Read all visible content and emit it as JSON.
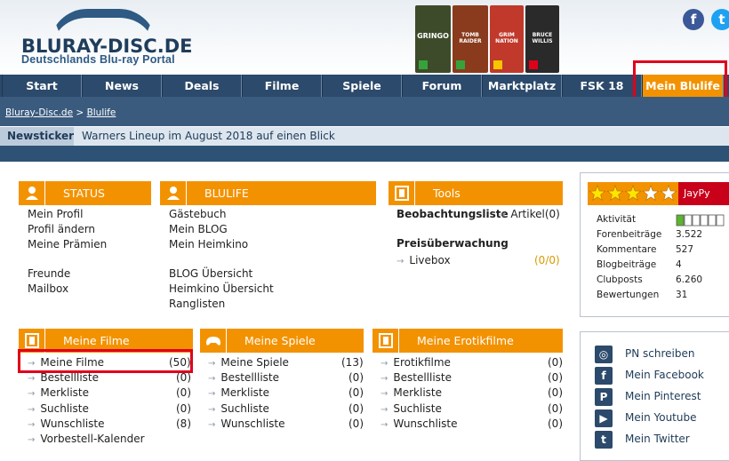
{
  "site": {
    "logo_title": "BLURAY-DISC.DE",
    "logo_subtitle": "Deutschlands Blu-ray Portal",
    "covers": [
      {
        "title": "GRINGO",
        "color": "#3d4b2a"
      },
      {
        "title": "TOMB RAIDER",
        "color": "#8a3b1d"
      },
      {
        "title": "GRIM NATION",
        "color": "#c0392b"
      },
      {
        "title": "BRUCE WILLIS",
        "color": "#2a2a2a"
      }
    ],
    "social_icons": [
      "facebook-icon",
      "twitter-icon"
    ],
    "colors": {
      "brand_dark": "#2c4a6b",
      "accent": "#f39200",
      "highlight": "#e0001a"
    }
  },
  "nav": {
    "items": [
      "Start",
      "News",
      "Deals",
      "Filme",
      "Spiele",
      "Forum",
      "Marktplatz",
      "FSK 18",
      "Mein Blulife"
    ],
    "active": "Mein Blulife"
  },
  "breadcrumb": {
    "items": [
      "Bluray-Disc.de",
      "Blulife"
    ],
    "separator": ">"
  },
  "newsticker": {
    "label": "Newsticker",
    "text": "Warners Lineup im August 2018 auf einen Blick"
  },
  "boxes": {
    "status": {
      "title": "STATUS",
      "icon": "user-icon",
      "links": [
        "Mein Profil",
        "Profil ändern",
        "Meine Prämien",
        "Freunde",
        "Mailbox"
      ]
    },
    "blulife": {
      "title": "BLULIFE",
      "icon": "user-icon",
      "links": [
        "Gästebuch",
        "Mein BLOG",
        "Mein Heimkino",
        "BLOG Übersicht",
        "Heimkino Übersicht",
        "Ranglisten"
      ]
    },
    "tools": {
      "title": "Tools",
      "icon": "film-icon",
      "watchlist_label": "Beobachtungsliste",
      "watchlist_item": "Artikel",
      "watchlist_count": "(0)",
      "price_label": "Preisüberwachung",
      "price_item": "Livebox",
      "price_count": "(0/0)"
    },
    "filme": {
      "title": "Meine Filme",
      "icon": "film-icon",
      "items": [
        {
          "label": "Meine Filme",
          "count": "(50)"
        },
        {
          "label": "Bestellliste",
          "count": "(0)"
        },
        {
          "label": "Merkliste",
          "count": "(0)"
        },
        {
          "label": "Suchliste",
          "count": "(0)"
        },
        {
          "label": "Wunschliste",
          "count": "(8)"
        },
        {
          "label": "Vorbestell-Kalender",
          "count": ""
        }
      ]
    },
    "spiele": {
      "title": "Meine Spiele",
      "icon": "gamepad-icon",
      "items": [
        {
          "label": "Meine Spiele",
          "count": "(13)"
        },
        {
          "label": "Bestellliste",
          "count": "(0)"
        },
        {
          "label": "Merkliste",
          "count": "(0)"
        },
        {
          "label": "Suchliste",
          "count": "(0)"
        },
        {
          "label": "Wunschliste",
          "count": "(0)"
        }
      ]
    },
    "erotik": {
      "title": "Meine Erotikfilme",
      "icon": "film-icon",
      "items": [
        {
          "label": "Erotikfilme",
          "count": "(0)"
        },
        {
          "label": "Bestellliste",
          "count": "(0)"
        },
        {
          "label": "Merkliste",
          "count": "(0)"
        },
        {
          "label": "Suchliste",
          "count": "(0)"
        },
        {
          "label": "Wunschliste",
          "count": "(0)"
        }
      ]
    }
  },
  "profile": {
    "username": "JayPy",
    "stars": 3,
    "stars_max": 5,
    "activity_label": "Aktivität",
    "activity_level": 1,
    "activity_max": 6,
    "stats": [
      {
        "label": "Forenbeiträge",
        "value": "3.522"
      },
      {
        "label": "Kommentare",
        "value": "527"
      },
      {
        "label": "Blogbeiträge",
        "value": "4"
      },
      {
        "label": "Clubposts",
        "value": "6.260"
      },
      {
        "label": "Bewertungen",
        "value": "31"
      }
    ]
  },
  "social_links": [
    {
      "label": "PN schreiben",
      "icon": "globe-icon"
    },
    {
      "label": "Mein Facebook",
      "icon": "facebook-icon"
    },
    {
      "label": "Mein Pinterest",
      "icon": "pinterest-icon"
    },
    {
      "label": "Mein Youtube",
      "icon": "youtube-icon"
    },
    {
      "label": "Mein Twitter",
      "icon": "twitter-icon"
    }
  ]
}
